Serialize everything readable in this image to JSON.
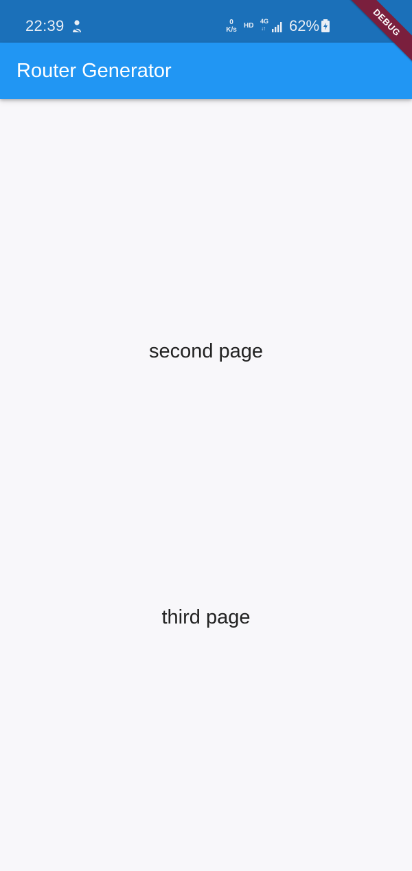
{
  "status_bar": {
    "time": "22:39",
    "speed_value": "0",
    "speed_unit": "K/s",
    "hd_label": "HD",
    "network_label": "4G",
    "network_arrows": "↓↑",
    "battery_percent": "62%",
    "notification_icon": "person-icon",
    "signal_icon": "signal-icon",
    "battery_icon": "battery-charging-icon",
    "background_color": "#1b70b9"
  },
  "debug_banner": {
    "label": "DEBUG",
    "color": "#7a1f3d"
  },
  "app_bar": {
    "title": "Router Generator",
    "background_color": "#2196f3"
  },
  "content": {
    "second_page": "second page",
    "third_page": "third page"
  }
}
